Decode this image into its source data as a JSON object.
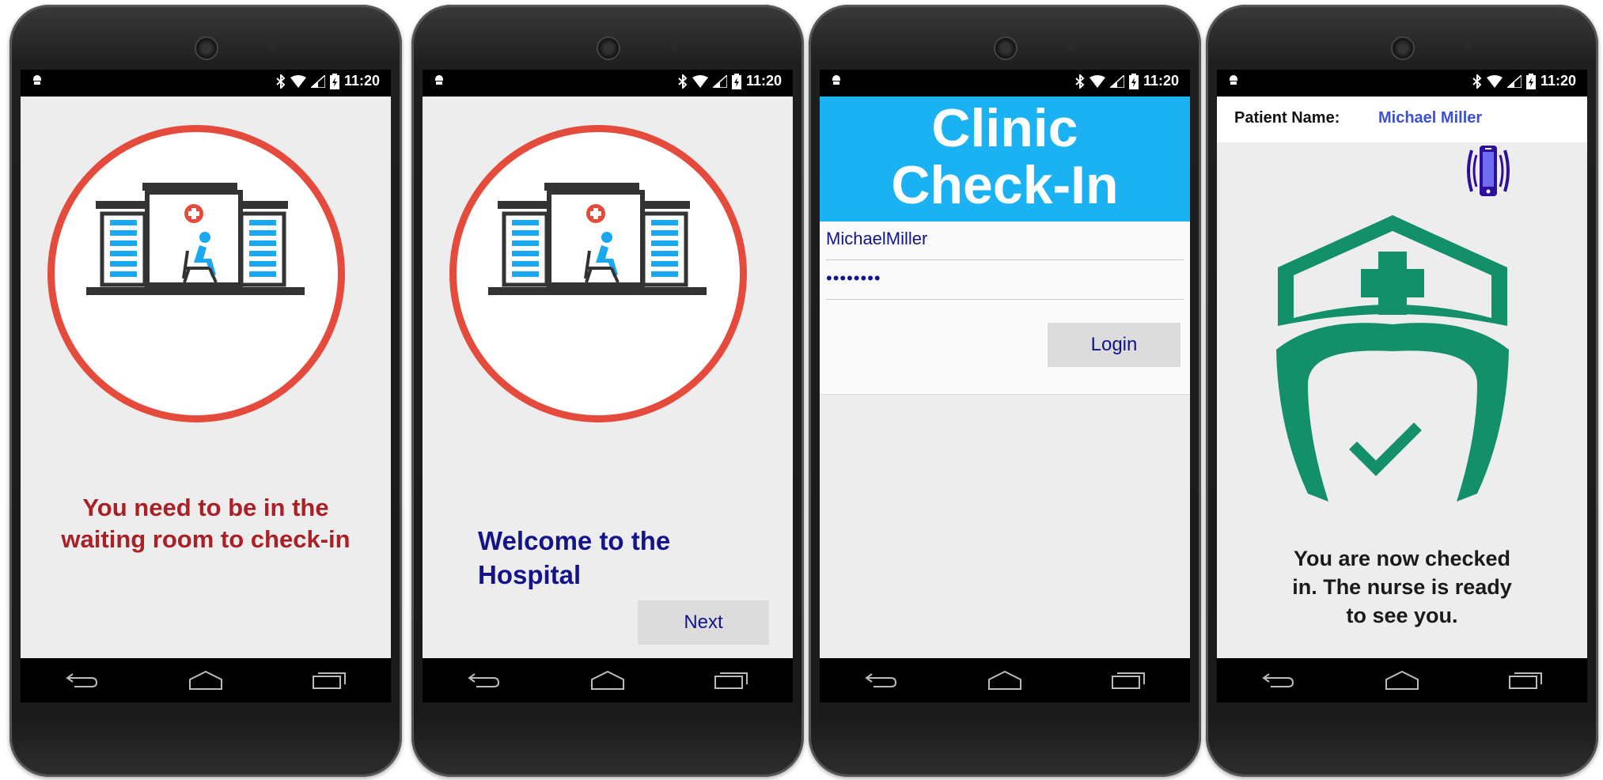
{
  "status_bar": {
    "time": "11:20"
  },
  "screens": [
    {
      "id": "waiting-room",
      "message_line1": "You need to be in the",
      "message_line2": "waiting room to check-in"
    },
    {
      "id": "welcome",
      "message_line1": "Welcome to the",
      "message_line2": "Hospital",
      "next_label": "Next"
    },
    {
      "id": "login",
      "banner_line1": "Clinic",
      "banner_line2": "Check-In",
      "username_value": "MichaelMiller",
      "password_value": "••••••••",
      "login_label": "Login"
    },
    {
      "id": "checked-in",
      "patient_label": "Patient Name:",
      "patient_value": "Michael Miller",
      "message_line1": "You are now checked",
      "message_line2": "in. The nurse is ready",
      "message_line3": "to see you."
    }
  ],
  "colors": {
    "circle_red": "#e54b3c",
    "message_red": "#a92026",
    "navy_text": "#14148a",
    "banner_blue": "#1ab2f2",
    "nurse_green": "#13906a",
    "patient_blue": "#3c4fd8",
    "phone_icon_purple": "#2e0f9b"
  }
}
